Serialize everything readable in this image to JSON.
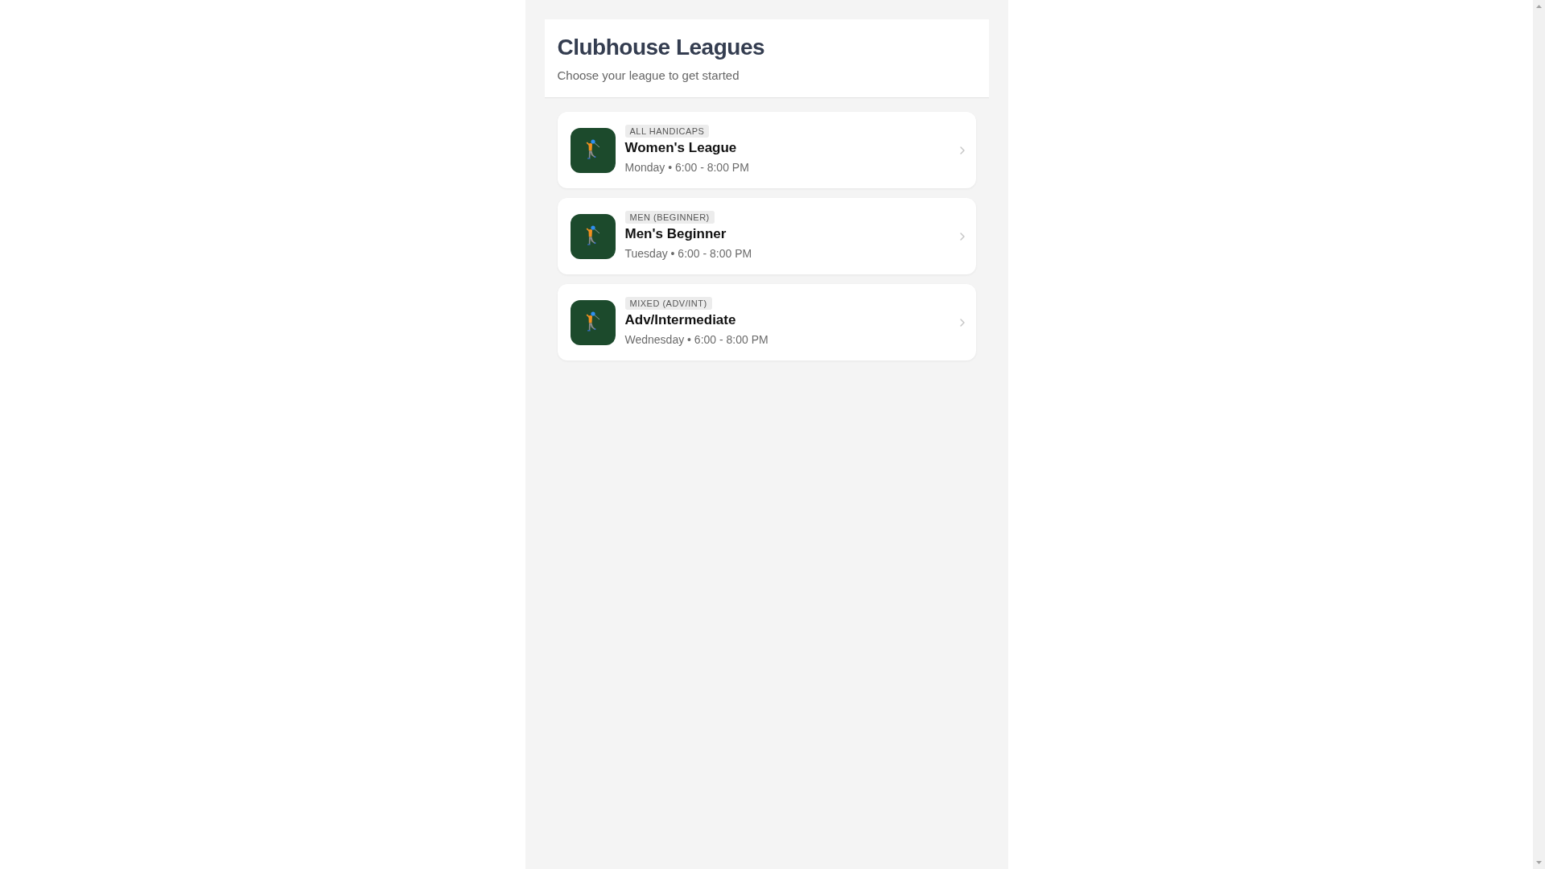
{
  "header": {
    "title": "Clubhouse Leagues",
    "subtitle": "Choose your league to get started"
  },
  "leagues": [
    {
      "badge": "ALL HANDICAPS",
      "name": "Women's League",
      "schedule": "Monday • 6:00 - 8:00 PM"
    },
    {
      "badge": "MEN (BEGINNER)",
      "name": "Men's Beginner",
      "schedule": "Tuesday • 6:00 - 8:00 PM"
    },
    {
      "badge": "MIXED (ADV/INT)",
      "name": "Adv/Intermediate",
      "schedule": "Wednesday • 6:00 - 8:00 PM"
    }
  ]
}
